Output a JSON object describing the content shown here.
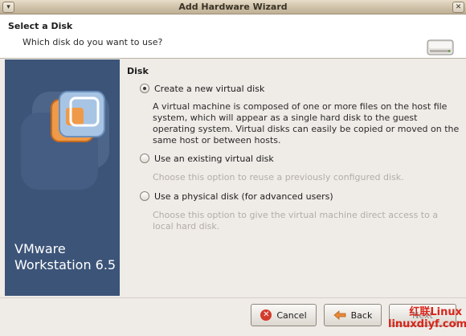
{
  "window": {
    "title": "Add Hardware Wizard",
    "controls": [
      "minimize-icon",
      "close-icon"
    ]
  },
  "header": {
    "title": "Select a Disk",
    "subtitle": "Which disk do you want to use?",
    "icon": "hard-disk-icon"
  },
  "sidebar": {
    "product_line1": "VMware",
    "product_line2": "Workstation 6.5"
  },
  "section": {
    "title": "Disk"
  },
  "options": [
    {
      "label": "Create a new virtual disk",
      "selected": true,
      "description": "A virtual machine is composed of one or more files on the host file system, which will appear as a single hard disk to the guest operating system. Virtual disks can easily be copied or moved on the same host or between hosts.",
      "enabled_description": true
    },
    {
      "label": "Use an existing virtual disk",
      "selected": false,
      "description": "Choose this option to reuse a previously configured disk.",
      "enabled_description": false
    },
    {
      "label": "Use a physical disk (for advanced users)",
      "selected": false,
      "description": "Choose this option to give the virtual machine direct access to a local hard disk.",
      "enabled_description": false
    }
  ],
  "buttons": {
    "cancel": "Cancel",
    "back": "Back",
    "next": "Next"
  },
  "watermark": {
    "line1": "红联Linux",
    "line2": "linuxdiyf.com"
  },
  "colors": {
    "sidebar": "#3c5478",
    "accent_orange": "#e8893a",
    "dim_text": "#b2ada6"
  }
}
